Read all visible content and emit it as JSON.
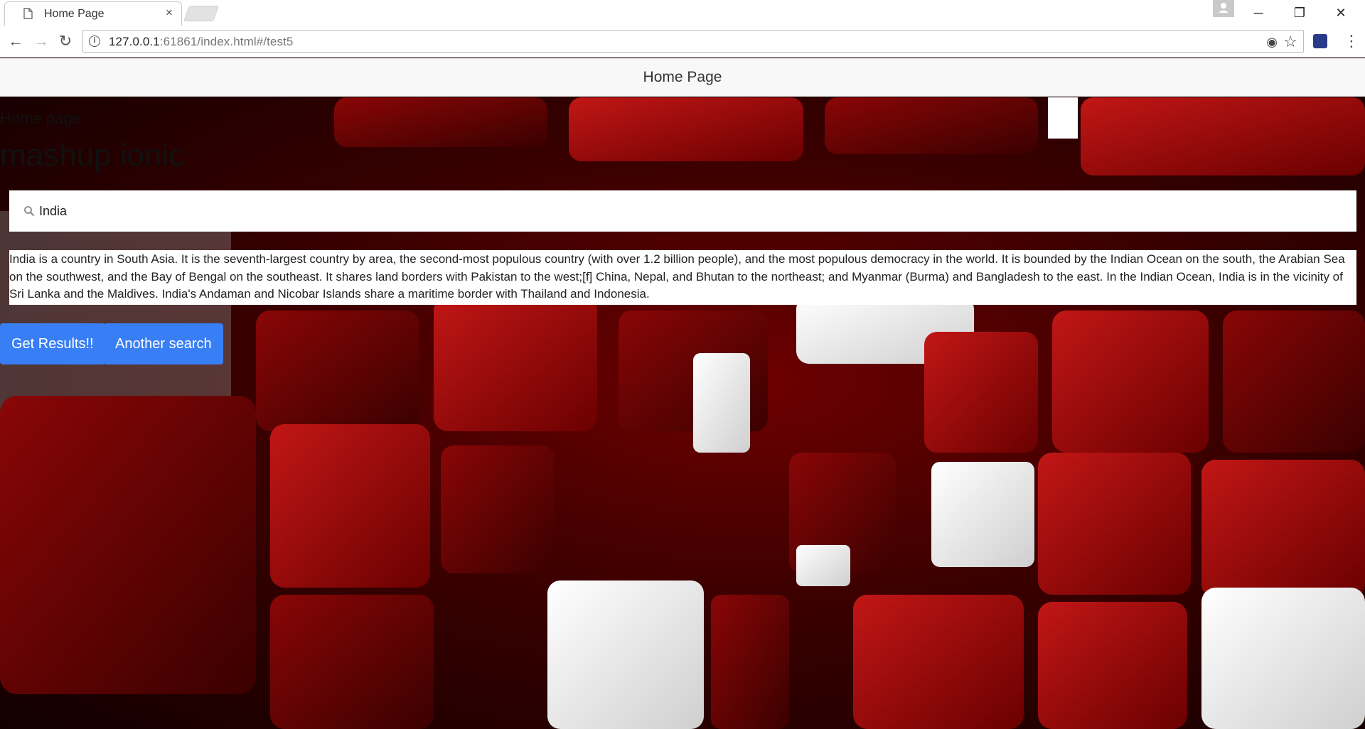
{
  "browser": {
    "tab_title": "Home Page",
    "tab_close": "×",
    "url_host": "127.0.0.1",
    "url_rest": ":61861/index.html#/test5",
    "window_controls": {
      "minimize": "─",
      "restore": "❐",
      "close": "✕"
    }
  },
  "app": {
    "header_title": "Home Page",
    "subtitle": "Home page",
    "title": "mashup ionic"
  },
  "search": {
    "value": "India"
  },
  "result_text": "India is a country in South Asia. It is the seventh-largest country by area, the second-most populous country (with over 1.2 billion people), and the most populous democracy in the world. It is bounded by the Indian Ocean on the south, the Arabian Sea on the southwest, and the Bay of Bengal on the southeast. It shares land borders with Pakistan to the west;[f] China, Nepal, and Bhutan to the northeast; and Myanmar (Burma) and Bangladesh to the east. In the Indian Ocean, India is in the vicinity of Sri Lanka and the Maldives. India's Andaman and Nicobar Islands share a maritime border with Thailand and Indonesia.",
  "buttons": {
    "get_results": "Get Results!!",
    "another_search": "Another search"
  },
  "colors": {
    "button": "#387ef5",
    "background_theme": "#8b0000"
  }
}
